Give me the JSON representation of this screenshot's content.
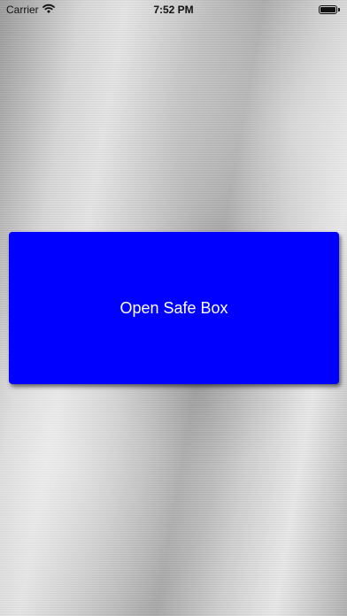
{
  "status_bar": {
    "carrier": "Carrier",
    "time": "7:52 PM",
    "battery_level": 1.0
  },
  "main": {
    "open_button_label": "Open Safe Box",
    "button_color": "#0000ff",
    "button_text_color": "#ffffff"
  },
  "icons": {
    "wifi": "wifi-icon",
    "battery": "battery-icon"
  }
}
